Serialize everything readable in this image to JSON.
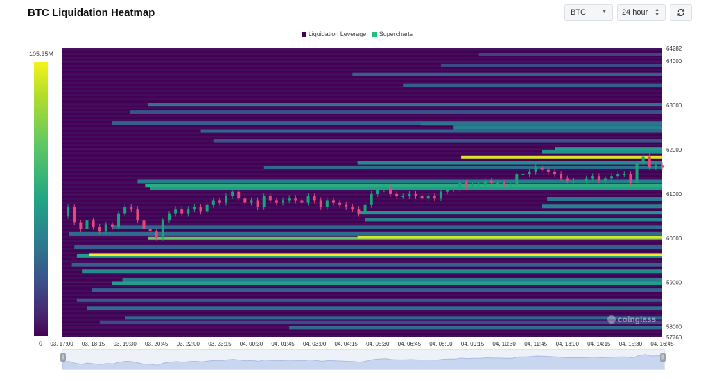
{
  "title": "BTC Liquidation Heatmap",
  "controls": {
    "symbol": "BTC",
    "range": "24 hour",
    "refresh_icon": "refresh-icon"
  },
  "legend": {
    "items": [
      {
        "label": "Liquidation Leverage",
        "color": "#440154"
      },
      {
        "label": "Supercharts",
        "color": "#21c17a"
      }
    ]
  },
  "colorbar": {
    "max_label": "105.35M",
    "min_label": "0"
  },
  "watermark": "coinglass",
  "chart_data": {
    "type": "heatmap",
    "title": "BTC Liquidation Heatmap",
    "x_ticks": [
      "03, 17:00",
      "03, 18:15",
      "03, 19:30",
      "03, 20:45",
      "03, 22:00",
      "03, 23:15",
      "04, 00:30",
      "04, 01:45",
      "04, 03:00",
      "04, 04:15",
      "04, 05:30",
      "04, 06:45",
      "04, 08:00",
      "04, 09:15",
      "04, 10:30",
      "04, 11:45",
      "04, 13:00",
      "04, 14:15",
      "04, 15:30",
      "04, 16:45"
    ],
    "y_ticks": [
      64282,
      64000,
      63000,
      62000,
      61000,
      60000,
      59000,
      58000,
      57760
    ],
    "ylim": [
      57760,
      64282
    ],
    "xlim_hours": [
      0,
      23.75
    ],
    "colorscale": {
      "min": 0,
      "max": 105350000,
      "unit": "USD"
    },
    "liquidation_bands": [
      {
        "price": 59630,
        "start_h": 1.1,
        "intensity": 1.0
      },
      {
        "price": 59600,
        "start_h": 0.6,
        "intensity": 0.55
      },
      {
        "price": 60000,
        "start_h": 3.4,
        "intensity": 0.75
      },
      {
        "price": 60020,
        "start_h": 11.7,
        "intensity": 0.95
      },
      {
        "price": 60100,
        "start_h": 0.3,
        "intensity": 0.35
      },
      {
        "price": 61830,
        "start_h": 15.8,
        "intensity": 0.95
      },
      {
        "price": 61190,
        "start_h": 3.3,
        "intensity": 0.62
      },
      {
        "price": 61120,
        "start_h": 3.5,
        "intensity": 0.55
      },
      {
        "price": 61280,
        "start_h": 3.0,
        "intensity": 0.42
      },
      {
        "price": 61950,
        "start_h": 19.0,
        "intensity": 0.5
      },
      {
        "price": 62020,
        "start_h": 19.5,
        "intensity": 0.55
      },
      {
        "price": 62500,
        "start_h": 15.5,
        "intensity": 0.45
      },
      {
        "price": 62580,
        "start_h": 14.2,
        "intensity": 0.4
      },
      {
        "price": 63020,
        "start_h": 3.4,
        "intensity": 0.38
      },
      {
        "price": 62600,
        "start_h": 2.0,
        "intensity": 0.3
      },
      {
        "price": 62420,
        "start_h": 5.5,
        "intensity": 0.32
      },
      {
        "price": 61700,
        "start_h": 11.7,
        "intensity": 0.48
      },
      {
        "price": 61600,
        "start_h": 8.0,
        "intensity": 0.35
      },
      {
        "price": 60580,
        "start_h": 11.7,
        "intensity": 0.52
      },
      {
        "price": 60420,
        "start_h": 12.0,
        "intensity": 0.45
      },
      {
        "price": 60250,
        "start_h": 2.0,
        "intensity": 0.33
      },
      {
        "price": 60720,
        "start_h": 19.0,
        "intensity": 0.45
      },
      {
        "price": 60880,
        "start_h": 19.2,
        "intensity": 0.4
      },
      {
        "price": 59250,
        "start_h": 0.8,
        "intensity": 0.48
      },
      {
        "price": 59050,
        "start_h": 2.4,
        "intensity": 0.42
      },
      {
        "price": 58980,
        "start_h": 2.0,
        "intensity": 0.55
      },
      {
        "price": 58830,
        "start_h": 1.2,
        "intensity": 0.3
      },
      {
        "price": 58600,
        "start_h": 0.6,
        "intensity": 0.28
      },
      {
        "price": 58420,
        "start_h": 1.0,
        "intensity": 0.35
      },
      {
        "price": 58200,
        "start_h": 2.5,
        "intensity": 0.33
      },
      {
        "price": 57980,
        "start_h": 9.0,
        "intensity": 0.33
      },
      {
        "price": 63700,
        "start_h": 11.5,
        "intensity": 0.3
      },
      {
        "price": 63450,
        "start_h": 13.5,
        "intensity": 0.3
      },
      {
        "price": 62850,
        "start_h": 2.7,
        "intensity": 0.25
      },
      {
        "price": 62200,
        "start_h": 6.0,
        "intensity": 0.25
      },
      {
        "price": 59800,
        "start_h": 0.5,
        "intensity": 0.3
      },
      {
        "price": 59400,
        "start_h": 0.4,
        "intensity": 0.3
      },
      {
        "price": 58100,
        "start_h": 1.5,
        "intensity": 0.22
      },
      {
        "price": 63900,
        "start_h": 15.0,
        "intensity": 0.22
      },
      {
        "price": 64150,
        "start_h": 16.5,
        "intensity": 0.2
      }
    ],
    "price_series": {
      "x_hours": [
        0.0,
        0.25,
        0.5,
        0.75,
        1.0,
        1.25,
        1.5,
        1.75,
        2.0,
        2.25,
        2.5,
        2.75,
        3.0,
        3.25,
        3.5,
        3.75,
        4.0,
        4.25,
        4.5,
        4.75,
        5.0,
        5.25,
        5.5,
        5.75,
        6.0,
        6.25,
        6.5,
        6.75,
        7.0,
        7.25,
        7.5,
        7.75,
        8.0,
        8.25,
        8.5,
        8.75,
        9.0,
        9.25,
        9.5,
        9.75,
        10.0,
        10.25,
        10.5,
        10.75,
        11.0,
        11.25,
        11.5,
        11.75,
        12.0,
        12.25,
        12.5,
        12.75,
        13.0,
        13.25,
        13.5,
        13.75,
        14.0,
        14.25,
        14.5,
        14.75,
        15.0,
        15.25,
        15.5,
        15.75,
        16.0,
        16.25,
        16.5,
        16.75,
        17.0,
        17.25,
        17.5,
        17.75,
        18.0,
        18.25,
        18.5,
        18.75,
        19.0,
        19.25,
        19.5,
        19.75,
        20.0,
        20.25,
        20.5,
        20.75,
        21.0,
        21.25,
        21.5,
        21.75,
        22.0,
        22.25,
        22.5,
        22.75,
        23.0,
        23.25,
        23.5,
        23.75
      ],
      "close": [
        60500,
        60700,
        60350,
        60200,
        60400,
        60250,
        60150,
        60300,
        60250,
        60550,
        60700,
        60650,
        60400,
        60200,
        60150,
        60000,
        60400,
        60550,
        60650,
        60550,
        60650,
        60700,
        60600,
        60750,
        60850,
        60800,
        60950,
        61050,
        60900,
        60800,
        60850,
        60700,
        60950,
        60850,
        60800,
        60850,
        60900,
        60850,
        60800,
        60950,
        60850,
        60700,
        60850,
        60800,
        60750,
        60700,
        60650,
        60550,
        60750,
        61000,
        61100,
        61150,
        61000,
        60950,
        60950,
        61000,
        60950,
        60900,
        60950,
        60900,
        61050,
        61100,
        61100,
        61250,
        61150,
        61200,
        61200,
        61300,
        61250,
        61250,
        61200,
        61200,
        61450,
        61450,
        61500,
        61600,
        61550,
        61500,
        61450,
        61350,
        61300,
        61300,
        61300,
        61350,
        61400,
        61300,
        61350,
        61400,
        61450,
        61450,
        61250,
        61700,
        61850,
        61600,
        61650,
        61600
      ]
    },
    "grid": true,
    "legend_position": "top-center"
  }
}
